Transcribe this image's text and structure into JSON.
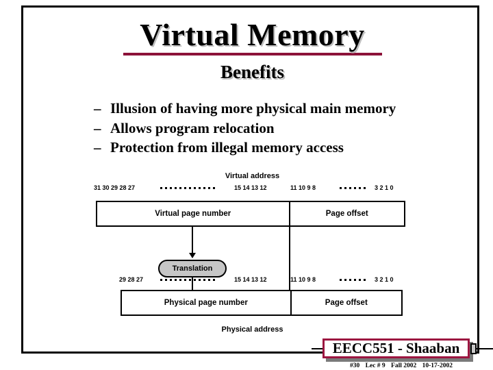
{
  "slide": {
    "title": "Virtual Memory",
    "subtitle": "Benefits",
    "bullet_marker": "–",
    "bullets": [
      "Illusion of having more physical main memory",
      "Allows program relocation",
      "Protection from illegal memory access"
    ],
    "accent_color": "#8c1239",
    "border_color": "#000000"
  },
  "diagram": {
    "virtual_address_caption": "Virtual address",
    "physical_address_caption": "Physical address",
    "translation_label": "Translation",
    "virtual_bits": {
      "group_left": "31 30 29 28 27",
      "group_mid": "15 14 13 12",
      "group_right_hi": "11 10 9 8",
      "group_right_lo": "3 2 1 0",
      "ellipsis_left_dots": 12,
      "ellipsis_right_dots": 6
    },
    "physical_bits": {
      "group_left": "29 28 27",
      "group_mid": "15 14 13 12",
      "group_right_hi": "11 10 9 8",
      "group_right_lo": "3 2 1 0",
      "ellipsis_left_dots": 12,
      "ellipsis_right_dots": 6
    },
    "virtual_fields": {
      "left": "Virtual page number",
      "right": "Page offset"
    },
    "physical_fields": {
      "left": "Physical page number",
      "right": "Page offset"
    }
  },
  "footer": {
    "badge": "EECC551 - Shaaban",
    "badge_border_color": "#9c1540",
    "slide_number": "#30",
    "lecture": "Lec # 9",
    "term": "Fall 2002",
    "date": "10-17-2002"
  }
}
